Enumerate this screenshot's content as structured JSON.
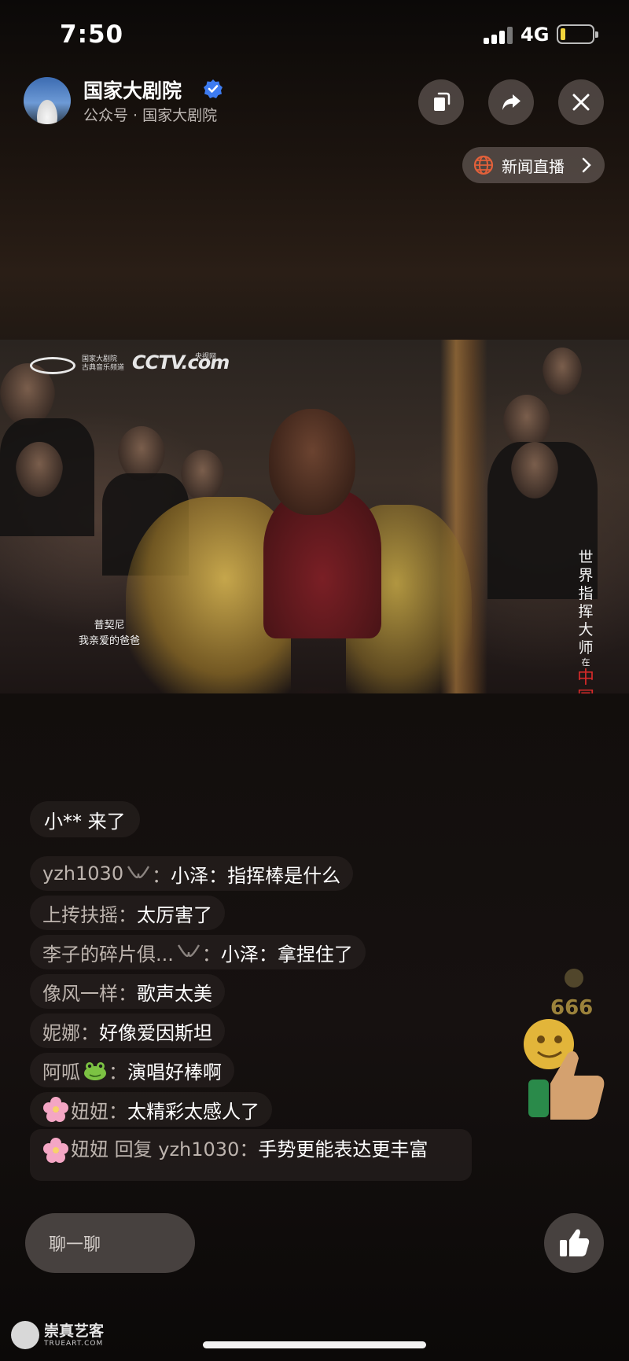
{
  "status_bar": {
    "time": "7:50",
    "network": "4G",
    "battery_fraction": 0.15
  },
  "header": {
    "account_name": "国家大剧院",
    "account_sub": "公众号 · 国家大剧院",
    "news_live_label": "新闻直播"
  },
  "video": {
    "channel_logo_text": "国家大剧院\n古典音乐频道",
    "cctv_logo": "CCTV.com",
    "cctv_small": "央视网",
    "caption_line1": "普契尼",
    "caption_line2": "我亲爱的爸爸",
    "vertical_title_a": "世界指挥大师",
    "vertical_title_b": "在",
    "vertical_title_c": "中国"
  },
  "join_notice": "小** 来了",
  "comments": [
    {
      "user": "yzh1030",
      "user_suffix": "：",
      "message": "小泽：指挥棒是什么",
      "badge": "ribbon-icon"
    },
    {
      "user": "上抟扶摇",
      "user_suffix": "：",
      "message": "太厉害了"
    },
    {
      "user": "李子的碎片俱...",
      "user_suffix": "：",
      "message": "小泽：拿捏住了",
      "badge": "ribbon-icon"
    },
    {
      "user": "像风一样",
      "user_suffix": "：",
      "message": "歌声太美"
    },
    {
      "user": "妮娜",
      "user_suffix": "：",
      "message": "好像爱因斯坦"
    },
    {
      "user": "阿呱",
      "user_suffix": "：",
      "message": "演唱好棒啊",
      "badge": "frog-icon"
    },
    {
      "user": "妞妞",
      "user_suffix": "：",
      "message": "太精彩太感人了",
      "prefix_icon": "flower-icon"
    },
    {
      "user": "妞妞 回复 yzh1030",
      "user_suffix": "：",
      "message": "手势更能表达更丰富",
      "prefix_icon": "flower-icon"
    }
  ],
  "sticker_text": "666",
  "chat_input": {
    "placeholder": "聊一聊"
  },
  "watermark": {
    "name": "崇真艺客",
    "sub": "TRUEART.COM"
  },
  "colors": {
    "accent_blue": "#3d7bf0",
    "globe_orange": "#e2603a",
    "username_gray": "#bdb4ae"
  }
}
